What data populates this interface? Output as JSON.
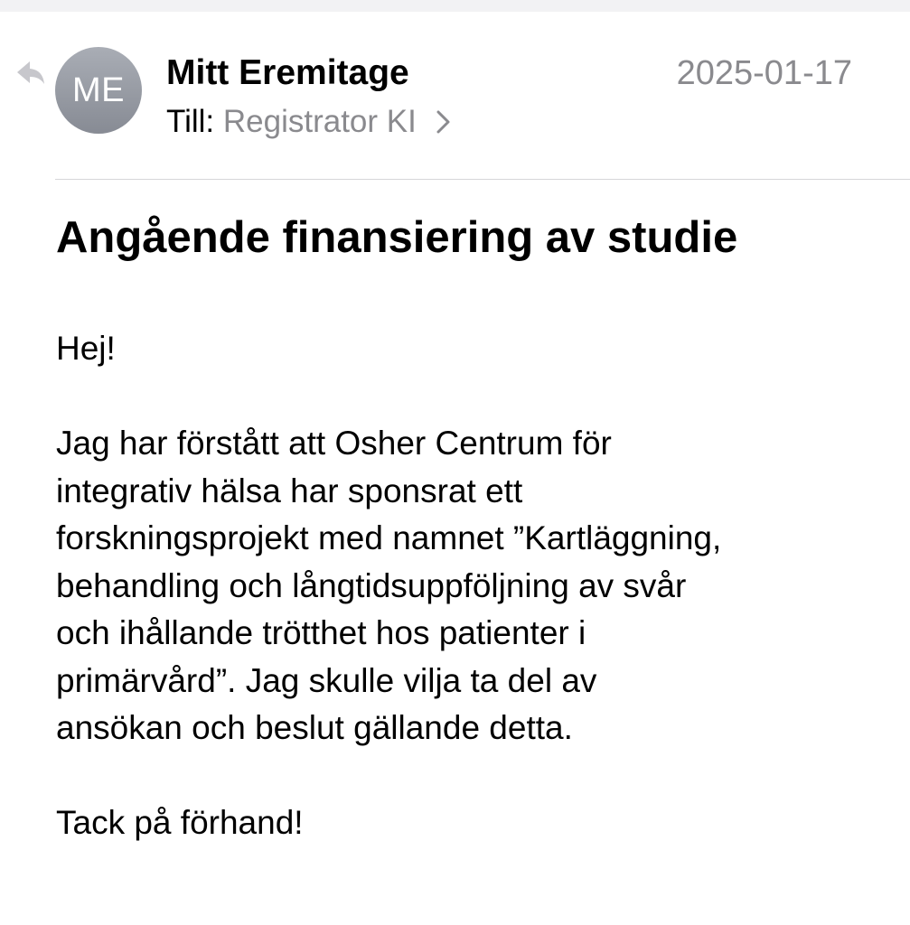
{
  "header": {
    "reply_icon": "reply-arrow-icon",
    "avatar_initials": "ME",
    "sender_name": "Mitt Eremitage",
    "date": "2025-01-17",
    "to_label": "Till:",
    "recipient": "Registrator KI",
    "recipient_chevron_icon": "chevron-right-icon"
  },
  "message": {
    "subject": "Angående finansiering av studie",
    "greeting": "Hej!",
    "body_lines": [
      "Jag har förstått att Osher Centrum för",
      "integrativ hälsa har sponsrat ett",
      "forskningsprojekt med namnet ”Kartläggning,",
      "behandling och långtidsuppföljning av svår",
      "och ihållande trötthet hos patienter i",
      "primärvård”. Jag skulle vilja ta del av",
      "ansökan och beslut gällande detta."
    ],
    "closing": "Tack på förhand!"
  },
  "colors": {
    "secondary_text": "#8a8a8e",
    "avatar_bg": "#9b9fa7",
    "divider": "#d6d6d9",
    "reply_icon": "#c7c7cc"
  }
}
